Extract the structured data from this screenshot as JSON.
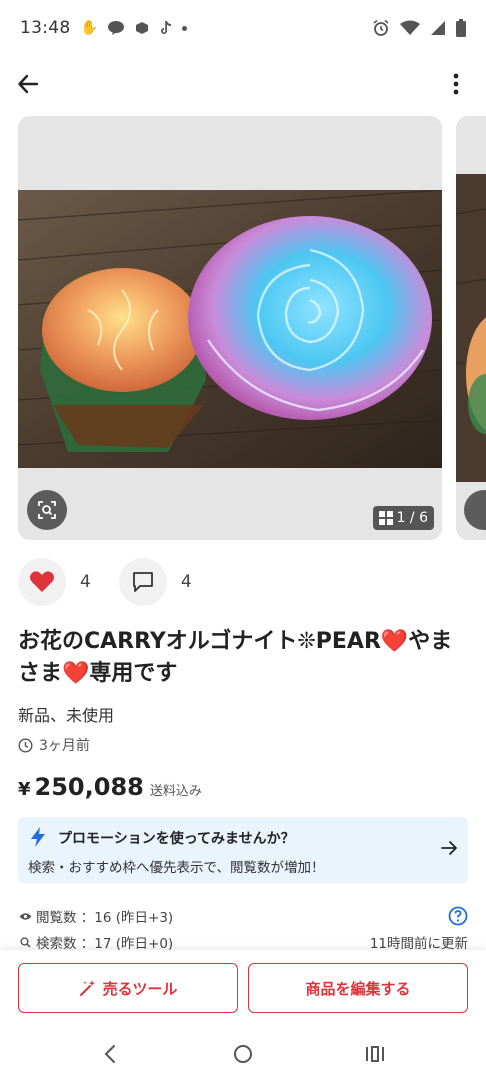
{
  "status_bar": {
    "time": "13:48",
    "left_icons": [
      "hand-icon",
      "line-icon",
      "app-icon",
      "tiktok-icon",
      "dot-icon"
    ],
    "right_icons": [
      "alarm-icon",
      "wifi-icon",
      "signal-icon",
      "battery-icon"
    ]
  },
  "app_bar": {
    "back_icon": "arrow-left-icon",
    "menu_icon": "more-vert-icon"
  },
  "gallery": {
    "counter": "1 / 6",
    "current_index": 1,
    "total_images": 6
  },
  "actions": {
    "likes": "4",
    "comments": "4"
  },
  "item": {
    "title": "お花のCARRYオルゴナイト❊PEAR❤️やまさま❤️専用です",
    "condition": "新品、未使用",
    "posted": "3ヶ月前",
    "price_currency": "¥",
    "price": "250,088",
    "price_note": "送料込み"
  },
  "promo": {
    "title": "プロモーションを使ってみませんか？",
    "body": "検索・おすすめ枠へ優先表示で、閲覧数が増加！"
  },
  "stats": {
    "views": "閲覧数 ：16 (昨日+3)",
    "searches": "検索数 ：17 (昨日+0)",
    "updated": "11時間前に更新"
  },
  "bottom": {
    "sell_tools": "売るツール",
    "edit_item": "商品を編集する"
  },
  "colors": {
    "accent": "#e0323b",
    "promo_bg": "#eaf4fd",
    "promo_icon": "#1e6fd9",
    "heart": "#e0323b"
  }
}
